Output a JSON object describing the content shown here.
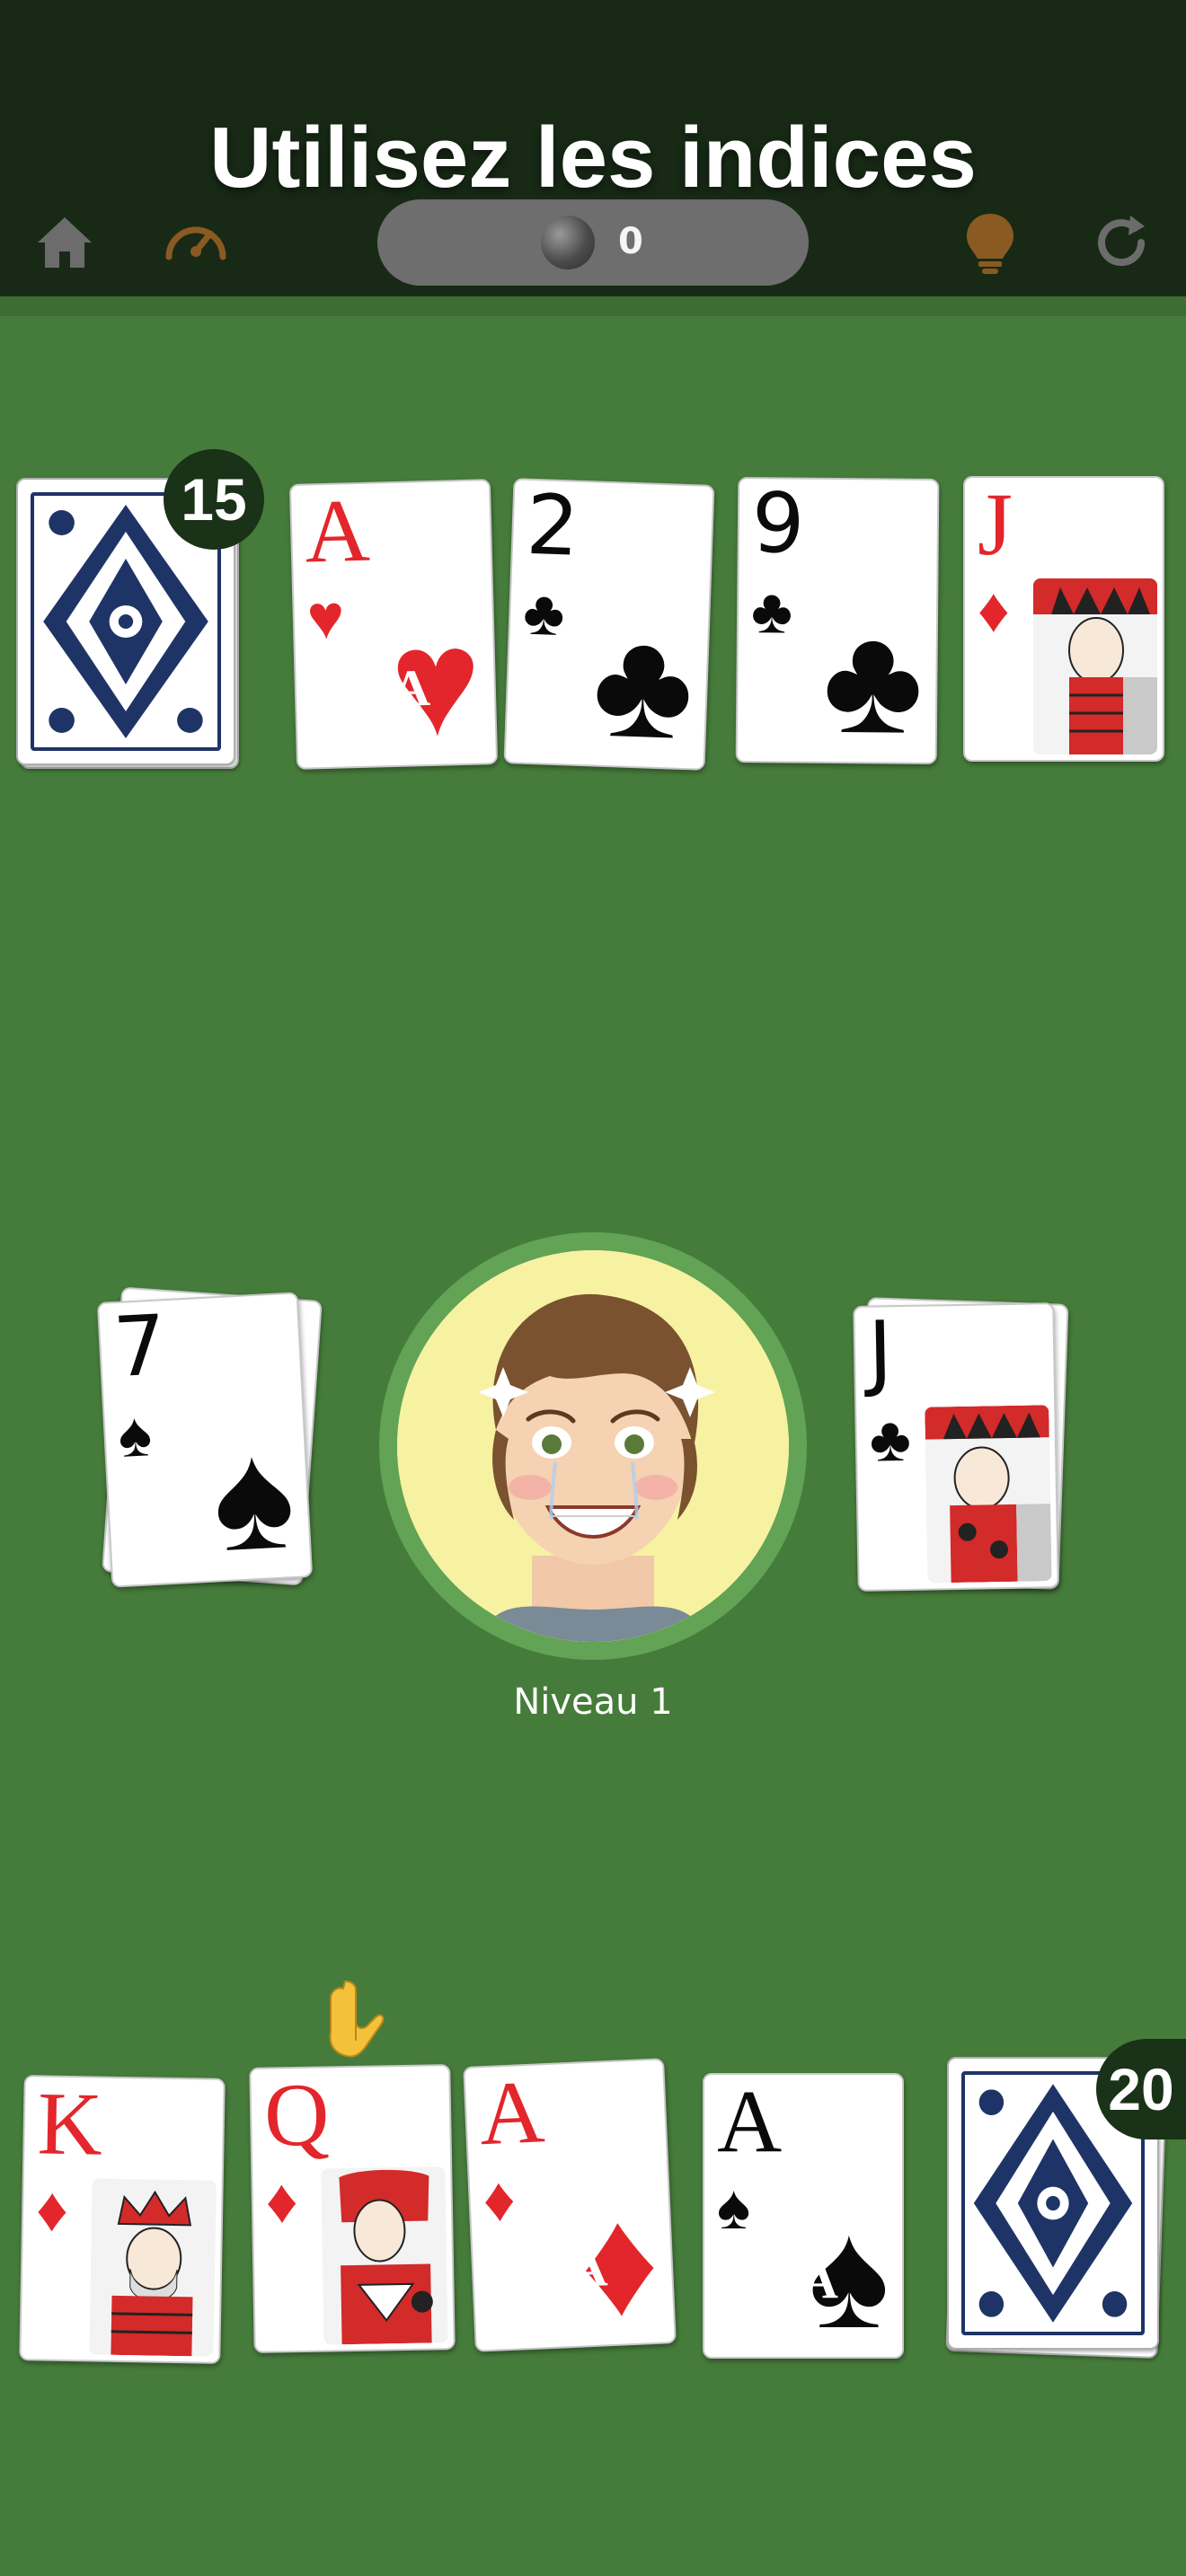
{
  "header": {
    "title": "Utilisez les indices",
    "coin_count": "0",
    "icons": [
      "home-icon",
      "speedometer-icon",
      "coin-icon",
      "lightbulb-icon",
      "refresh-icon"
    ]
  },
  "opponent": {
    "deck_count": "15",
    "cards": [
      {
        "rank": "A",
        "suit": "♥",
        "color": "#e3262b"
      },
      {
        "rank": "2",
        "suit": "♣",
        "color": "#0a0a0a"
      },
      {
        "rank": "9",
        "suit": "♣",
        "color": "#0a0a0a"
      },
      {
        "rank": "J",
        "suit": "♦",
        "color": "#e3262b"
      }
    ]
  },
  "center": {
    "left_pile": {
      "rank": "7",
      "suit": "♠"
    },
    "right_pile": {
      "rank": "J",
      "suit": "♣"
    },
    "level_label": "Niveau 1"
  },
  "player": {
    "deck_count": "20",
    "cards": [
      {
        "rank": "K",
        "suit": "♦",
        "color": "#e3262b"
      },
      {
        "rank": "Q",
        "suit": "♦",
        "color": "#e3262b"
      },
      {
        "rank": "A",
        "suit": "♦",
        "color": "#e3262b"
      },
      {
        "rank": "A",
        "suit": "♠",
        "color": "#0a0a0a"
      }
    ],
    "hint_icon": "pointing-down-hand-icon"
  },
  "colors": {
    "felt": "#467c3b",
    "topbar": "#182a16",
    "card_red": "#e3262b",
    "card_back_blue": "#1f3466",
    "avatar_ring": "#62a356",
    "avatar_bg": "#f7f1a2"
  }
}
